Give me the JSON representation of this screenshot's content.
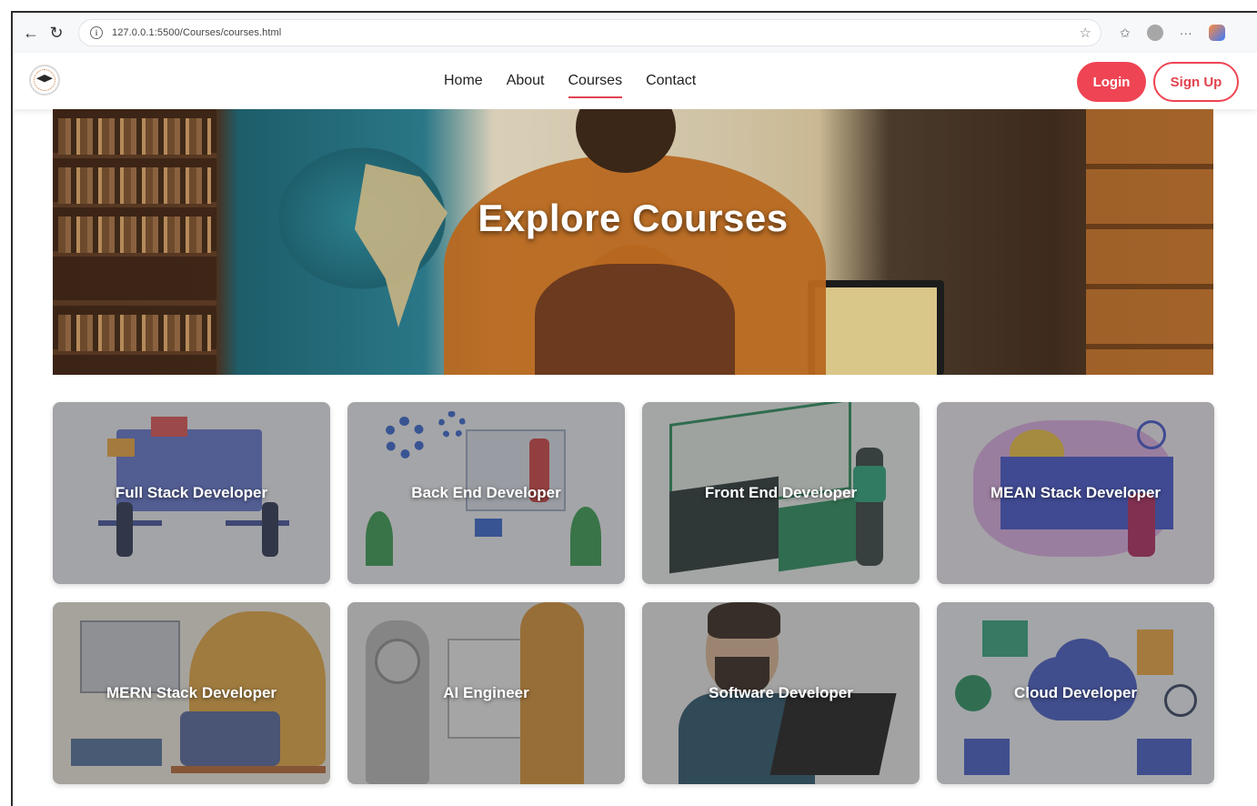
{
  "browser": {
    "url": "127.0.0.1:5500/Courses/courses.html",
    "back_icon": "←",
    "reload_icon": "↻",
    "star_icon": "☆",
    "more_icon": "···"
  },
  "header": {
    "nav": [
      {
        "label": "Home"
      },
      {
        "label": "About"
      },
      {
        "label": "Courses"
      },
      {
        "label": "Contact"
      }
    ],
    "active_nav": "Courses",
    "login_label": "Login",
    "signup_label": "Sign Up",
    "accent_color": "#ef4453"
  },
  "hero": {
    "title": "Explore Courses"
  },
  "courses": [
    {
      "title": "Full Stack Developer"
    },
    {
      "title": "Back End Developer"
    },
    {
      "title": "Front End Developer"
    },
    {
      "title": "MEAN Stack Developer"
    },
    {
      "title": "MERN Stack Developer"
    },
    {
      "title": "AI Engineer"
    },
    {
      "title": "Software Developer"
    },
    {
      "title": "Cloud Developer"
    }
  ]
}
